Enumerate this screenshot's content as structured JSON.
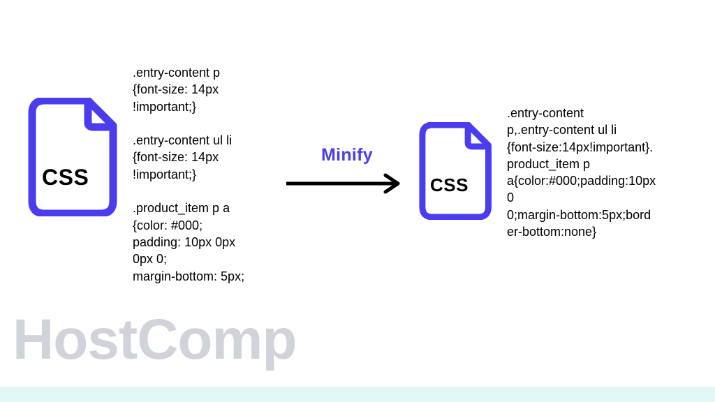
{
  "diagram": {
    "left_file": {
      "label": "CSS"
    },
    "right_file": {
      "label": "CSS"
    },
    "arrow": {
      "label": "Minify"
    },
    "left_code": ".entry-content p\n{font-size: 14px\n!important;}\n\n.entry-content ul li\n{font-size: 14px\n!important;}\n\n.product_item p a\n{color: #000;\npadding: 10px 0px\n0px 0;\nmargin-bottom: 5px;",
    "right_code": ".entry-content\np,.entry-content ul li\n{font-size:14px!important}.\nproduct_item p\na{color:#000;padding:10px\n0\n0;margin-bottom:5px;bord\ner-bottom:none}"
  },
  "watermark": "HostComp",
  "colors": {
    "accent": "#4a3df0",
    "watermark": "#d0d4da",
    "strip": "#e2f6f6"
  }
}
